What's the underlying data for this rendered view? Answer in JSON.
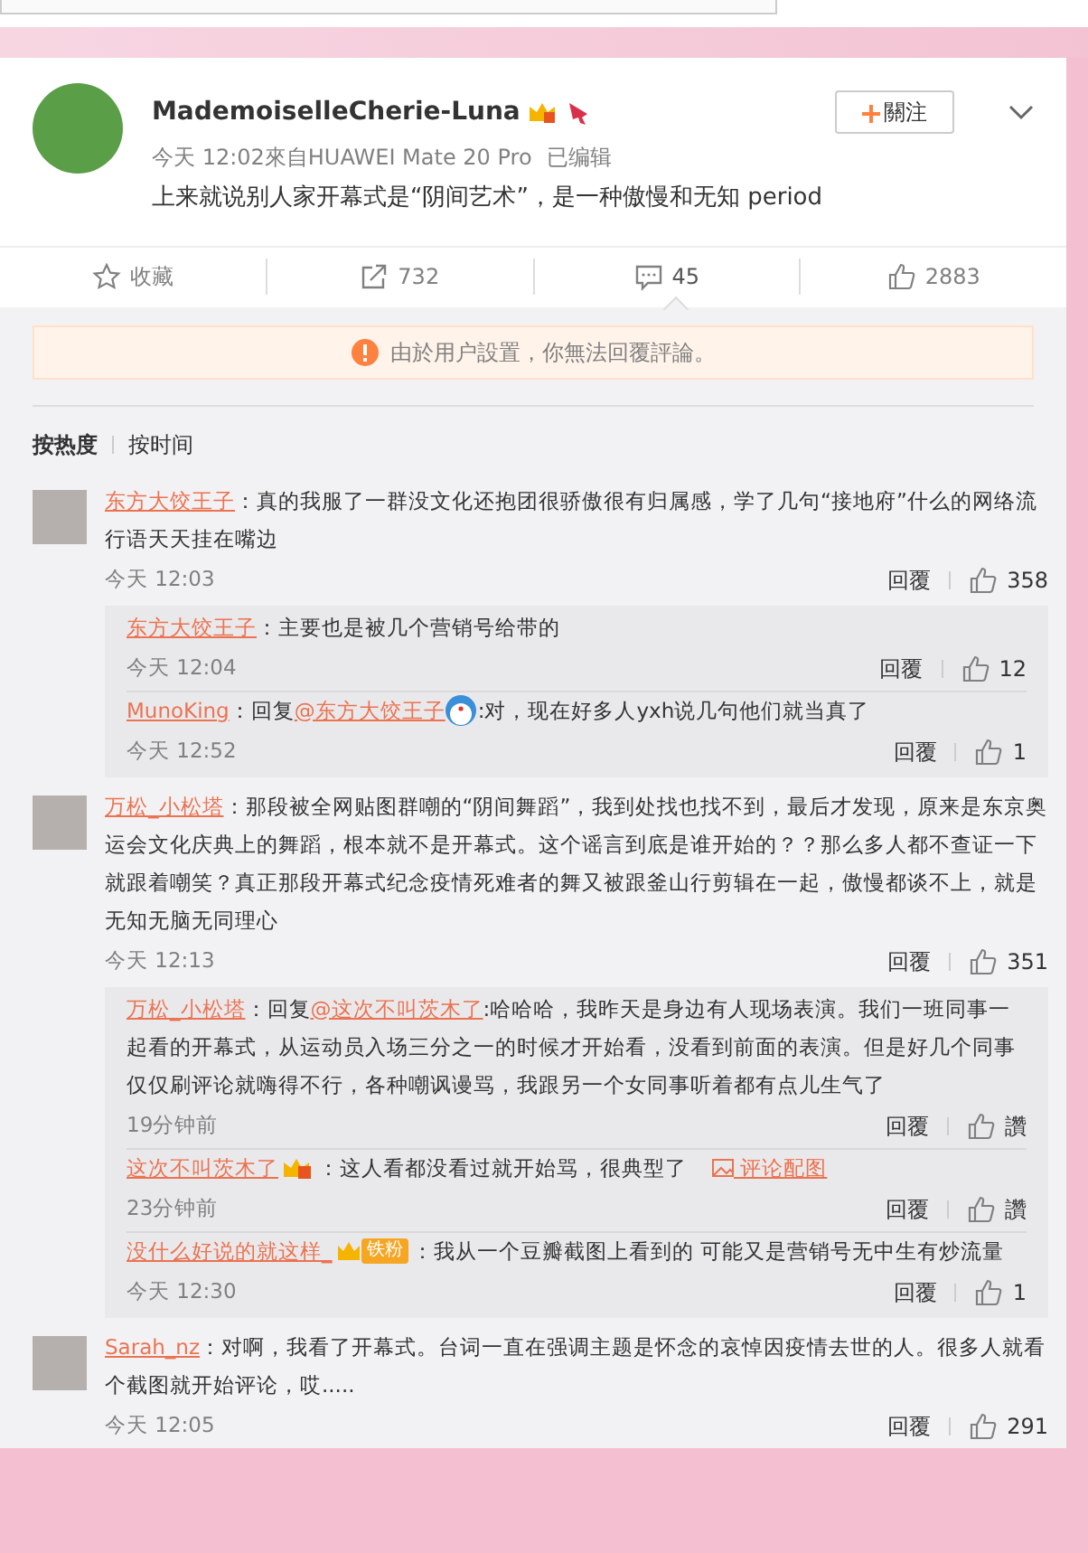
{
  "post": {
    "author": "MademoiselleCherie-Luna",
    "follow_label": "關注",
    "meta": "今天 12:02來自HUAWEI Mate 20 Pro",
    "edited": "已编辑",
    "text": "上来就说别人家开幕式是“阴间艺术”，是一种傲慢和无知 period"
  },
  "actions": [
    {
      "kind": "star",
      "label": "收藏",
      "selected": false
    },
    {
      "kind": "share",
      "label": "732",
      "selected": false
    },
    {
      "kind": "comment",
      "label": "45",
      "selected": true
    },
    {
      "kind": "like",
      "label": "2883",
      "selected": false
    }
  ],
  "notice": "由於用户設置，你無法回覆評論。",
  "sort_tabs": [
    {
      "label": "按热度",
      "selected": true
    },
    {
      "label": "按时间",
      "selected": false
    }
  ],
  "comments": [
    {
      "user": "东方大饺王子",
      "text": "：真的我服了一群没文化还抱团很骄傲很有归属感，学了几句“接地府”什么的网络流行语天天挂在嘴边",
      "time": "今天 12:03",
      "reply_label": "回覆",
      "likes": "358",
      "replies": [
        {
          "user": "东方大饺王子",
          "text": "：主要也是被几个营销号给带的",
          "time": "今天 12:04",
          "reply_label": "回覆",
          "likes": "12"
        },
        {
          "user": "MunoKing",
          "prefix": "：回复",
          "mention": "@东方大饺王子",
          "emoji": true,
          "text": ":对，现在好多人yxh说几句他们就当真了",
          "time": "今天 12:52",
          "reply_label": "回覆",
          "likes": "1"
        }
      ]
    },
    {
      "user": "万松_小松塔",
      "text": "：那段被全网贴图群嘲的“阴间舞蹈”，我到处找也找不到，最后才发现，原来是东京奥运会文化庆典上的舞蹈，根本就不是开幕式。这个谣言到底是谁开始的？？那么多人都不查证一下就跟着嘲笑？真正那段开幕式纪念疫情死难者的舞又被跟釜山行剪辑在一起，傲慢都谈不上，就是无知无脑无同理心",
      "time": "今天 12:13",
      "reply_label": "回覆",
      "likes": "351",
      "replies": [
        {
          "user": "万松_小松塔",
          "prefix": "：回复",
          "mention": "@这次不叫茨木了",
          "text": ":哈哈哈，我昨天是身边有人现场表演。我们一班同事一起看的开幕式，从运动员入场三分之一的时候才开始看，没看到前面的表演。但是好几个同事仅仅刷评论就嗨得不行，各种嘲讽谩骂，我跟另一个女同事听着都有点儿生气了",
          "time": "19分钟前",
          "reply_label": "回覆",
          "likes": "讚"
        },
        {
          "user": "这次不叫茨木了",
          "badges": [
            {
              "kind": "crown"
            }
          ],
          "text": "：这人看都没看过就开始骂，很典型了",
          "attachment": "评论配图",
          "time": "23分钟前",
          "reply_label": "回覆",
          "likes": "讚"
        },
        {
          "user": "没什么好说的就这样_",
          "badges": [
            {
              "kind": "fan",
              "label": "铁粉"
            }
          ],
          "text": "：我从一个豆瓣截图上看到的 可能又是营销号无中生有炒流量",
          "time": "今天 12:30",
          "reply_label": "回覆",
          "likes": "1"
        }
      ]
    },
    {
      "user": "Sarah_nz",
      "text": "：对啊，我看了开幕式。台词一直在强调主题是怀念的哀悼因疫情去世的人。很多人就看个截图就开始评论，哎.....",
      "time": "今天 12:05",
      "reply_label": "回覆",
      "likes": "291"
    }
  ]
}
